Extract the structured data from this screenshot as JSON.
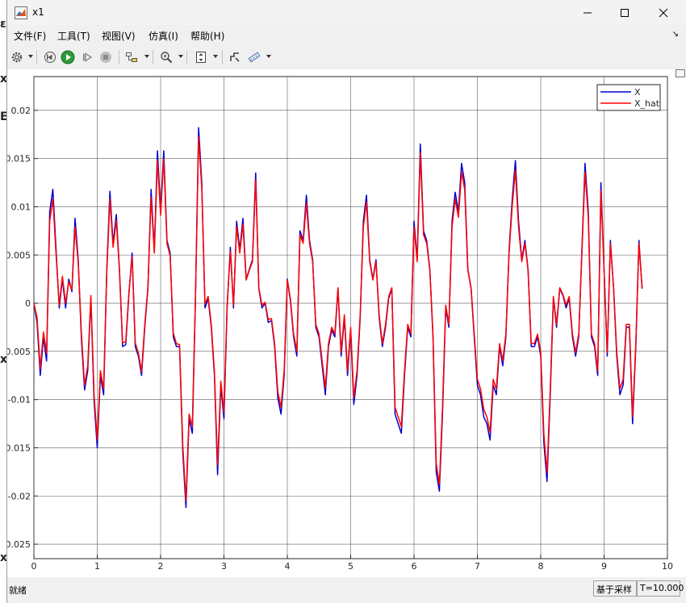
{
  "window": {
    "title": "x1"
  },
  "menu": {
    "items": [
      "文件(F)",
      "工具(T)",
      "视图(V)",
      "仿真(I)",
      "帮助(H)"
    ]
  },
  "toolbar": {
    "icons": [
      "gear-icon",
      "step-back-icon",
      "run-icon",
      "step-forward-icon",
      "stop-icon",
      "signal-select-icon",
      "zoom-icon",
      "fit-icon",
      "style-icon",
      "measure-icon"
    ]
  },
  "status": {
    "ready": "就绪",
    "sample_mode": "基于采样",
    "time": "T=10.000"
  },
  "colors": {
    "X": "#0000cd",
    "X_hat": "#ff0000"
  },
  "chart_data": {
    "type": "line",
    "xlim": [
      0,
      10
    ],
    "ylim": [
      -0.0265,
      0.0235
    ],
    "xticks": [
      "0",
      "1",
      "2",
      "3",
      "4",
      "5",
      "6",
      "7",
      "8",
      "9",
      "10"
    ],
    "yticks": [
      "0.02",
      "0.015",
      "0.01",
      "0.005",
      "0",
      "-0.005",
      "-0.01",
      "-0.015",
      "-0.02",
      "-0.025"
    ],
    "grid": true,
    "legend_position": "top-right",
    "series": [
      {
        "name": "X"
      },
      {
        "name": "X_hat"
      }
    ],
    "x": [
      0,
      0.05,
      0.1,
      0.15,
      0.2,
      0.25,
      0.3,
      0.35,
      0.4,
      0.45,
      0.5,
      0.55,
      0.6,
      0.65,
      0.7,
      0.75,
      0.8,
      0.85,
      0.9,
      0.95,
      1.0,
      1.05,
      1.1,
      1.15,
      1.2,
      1.25,
      1.3,
      1.35,
      1.4,
      1.45,
      1.5,
      1.55,
      1.6,
      1.65,
      1.7,
      1.75,
      1.8,
      1.85,
      1.9,
      1.95,
      2.0,
      2.05,
      2.1,
      2.15,
      2.2,
      2.25,
      2.3,
      2.35,
      2.4,
      2.45,
      2.5,
      2.55,
      2.6,
      2.65,
      2.7,
      2.75,
      2.8,
      2.85,
      2.9,
      2.95,
      3.0,
      3.05,
      3.1,
      3.15,
      3.2,
      3.25,
      3.3,
      3.35,
      3.4,
      3.45,
      3.5,
      3.55,
      3.6,
      3.65,
      3.7,
      3.75,
      3.8,
      3.85,
      3.9,
      3.95,
      4.0,
      4.05,
      4.1,
      4.15,
      4.2,
      4.25,
      4.3,
      4.35,
      4.4,
      4.45,
      4.5,
      4.55,
      4.6,
      4.65,
      4.7,
      4.75,
      4.8,
      4.85,
      4.9,
      4.95,
      5.0,
      5.05,
      5.1,
      5.15,
      5.2,
      5.25,
      5.3,
      5.35,
      5.4,
      5.45,
      5.5,
      5.55,
      5.6,
      5.65,
      5.7,
      5.75,
      5.8,
      5.85,
      5.9,
      5.95,
      6.0,
      6.05,
      6.1,
      6.15,
      6.2,
      6.25,
      6.3,
      6.35,
      6.4,
      6.45,
      6.5,
      6.55,
      6.6,
      6.65,
      6.7,
      6.75,
      6.8,
      6.85,
      6.9,
      6.95,
      7.0,
      7.05,
      7.1,
      7.15,
      7.2,
      7.25,
      7.3,
      7.35,
      7.4,
      7.45,
      7.5,
      7.55,
      7.6,
      7.65,
      7.7,
      7.75,
      7.8,
      7.85,
      7.9,
      7.95,
      8.0,
      8.05,
      8.1,
      8.15,
      8.2,
      8.25,
      8.3,
      8.35,
      8.4,
      8.45,
      8.5,
      8.55,
      8.6,
      8.65,
      8.7,
      8.75,
      8.8,
      8.85,
      8.9,
      8.95,
      9.0,
      9.05,
      9.1,
      9.15,
      9.2,
      9.25,
      9.3,
      9.35,
      9.4,
      9.45,
      9.5,
      9.55,
      9.6,
      9.65,
      9.7,
      9.75,
      9.8,
      9.85,
      9.9,
      9.95,
      10.0
    ],
    "x_values": [
      0,
      -0.002,
      -0.0075,
      -0.0035,
      -0.006,
      0.0095,
      0.0118,
      0.0055,
      -0.0005,
      0.0025,
      -0.0005,
      0.0025,
      0.0012,
      0.0088,
      0.0045,
      -0.0038,
      -0.009,
      -0.007,
      0.0005,
      -0.0102,
      -0.015,
      -0.0075,
      -0.0095,
      0.0035,
      0.0116,
      0.0062,
      0.0092,
      0.0035,
      -0.0045,
      -0.0043,
      0.001,
      0.0052,
      -0.0045,
      -0.0055,
      -0.0075,
      -0.0025,
      0.0015,
      0.0118,
      0.0055,
      0.0158,
      0.0095,
      0.0158,
      0.0065,
      0.0052,
      -0.0035,
      -0.0045,
      -0.0045,
      -0.0155,
      -0.0212,
      -0.012,
      -0.0135,
      0.0005,
      0.0182,
      0.0125,
      -0.0005,
      0.0005,
      -0.0025,
      -0.0075,
      -0.0178,
      -0.0085,
      -0.012,
      -0.0005,
      0.0058,
      -0.0005,
      0.0085,
      0.0055,
      0.0088,
      0.0025,
      0.0035,
      0.0045,
      0.0135,
      0.0015,
      -0.0005,
      0.0,
      -0.002,
      -0.0018,
      -0.0045,
      -0.0098,
      -0.0115,
      -0.0075,
      0.0025,
      0.0002,
      -0.0035,
      -0.0055,
      0.0075,
      0.0065,
      0.0112,
      0.0065,
      0.0045,
      -0.0025,
      -0.0035,
      -0.0065,
      -0.0095,
      -0.0045,
      -0.0028,
      -0.0035,
      0.0015,
      -0.0055,
      -0.0015,
      -0.0075,
      -0.0028,
      -0.0105,
      -0.0075,
      -0.0015,
      0.0085,
      0.0112,
      0.0045,
      0.0025,
      0.0045,
      -0.0015,
      -0.0045,
      -0.0025,
      0.0005,
      0.0015,
      -0.0115,
      -0.0125,
      -0.0135,
      -0.0075,
      -0.0025,
      -0.0035,
      0.0085,
      0.0045,
      0.0165,
      0.0075,
      0.0065,
      0.0035,
      -0.0035,
      -0.0175,
      -0.0195,
      -0.0115,
      -0.0005,
      -0.0025,
      0.0085,
      0.0115,
      0.0095,
      0.0145,
      0.0125,
      0.0035,
      0.0015,
      -0.0035,
      -0.0085,
      -0.0095,
      -0.0118,
      -0.0125,
      -0.0142,
      -0.0085,
      -0.0095,
      -0.0045,
      -0.0065,
      -0.0035,
      0.0055,
      0.0108,
      0.0148,
      0.0085,
      0.0045,
      0.0065,
      0.0035,
      -0.0045,
      -0.0045,
      -0.0035,
      -0.0055,
      -0.0145,
      -0.0185,
      -0.0095,
      0.0005,
      -0.0025,
      0.0015,
      0.0008,
      -0.0005,
      0.0005,
      -0.0035,
      -0.0055,
      -0.0035,
      0.0055,
      0.0145,
      0.0095,
      -0.0035,
      -0.0045,
      -0.0075,
      0.0125,
      0.0035,
      -0.0055,
      0.0065,
      0.0015,
      -0.0055,
      -0.0095,
      -0.0085,
      -0.0025,
      -0.0025,
      -0.0125,
      -0.0045,
      0.0065,
      0.0015
    ],
    "x_hat_values": [
      0,
      -0.0015,
      -0.0068,
      -0.003,
      -0.0052,
      0.0085,
      0.0108,
      0.005,
      -0.0002,
      0.0028,
      0.0,
      0.0022,
      0.0014,
      0.0079,
      0.0042,
      -0.0032,
      -0.0085,
      -0.0065,
      0.0008,
      -0.0095,
      -0.0142,
      -0.007,
      -0.0089,
      0.0032,
      0.0108,
      0.0058,
      0.0086,
      0.0034,
      -0.0041,
      -0.004,
      0.0012,
      0.0048,
      -0.0041,
      -0.0052,
      -0.0071,
      -0.0022,
      0.0017,
      0.011,
      0.0052,
      0.0148,
      0.0091,
      0.015,
      0.0062,
      0.0049,
      -0.0031,
      -0.0042,
      -0.0043,
      -0.0148,
      -0.0205,
      -0.0115,
      -0.0128,
      0.0008,
      0.0172,
      0.0119,
      -0.0001,
      0.0007,
      -0.0022,
      -0.0071,
      -0.0168,
      -0.0081,
      -0.0113,
      -0.0002,
      0.0054,
      -0.0002,
      0.0079,
      0.0052,
      0.0082,
      0.0024,
      0.0034,
      0.0043,
      0.0128,
      0.0016,
      -0.0002,
      0.0001,
      -0.0017,
      -0.0016,
      -0.0042,
      -0.0092,
      -0.0108,
      -0.007,
      0.0024,
      0.0004,
      -0.0032,
      -0.005,
      0.0071,
      0.0062,
      0.0104,
      0.0062,
      0.0043,
      -0.0022,
      -0.0032,
      -0.006,
      -0.0088,
      -0.0042,
      -0.0025,
      -0.0032,
      0.0016,
      -0.0051,
      -0.0012,
      -0.007,
      -0.0025,
      -0.0098,
      -0.007,
      -0.0012,
      0.0079,
      0.0105,
      0.0043,
      0.0024,
      0.0043,
      -0.0012,
      -0.0042,
      -0.0022,
      0.0007,
      0.0016,
      -0.0108,
      -0.0118,
      -0.0128,
      -0.007,
      -0.0022,
      -0.0032,
      0.0079,
      0.0043,
      0.0156,
      0.0071,
      0.0062,
      0.0034,
      -0.0032,
      -0.0166,
      -0.0188,
      -0.0108,
      -0.0002,
      -0.0022,
      0.0079,
      0.0108,
      0.0089,
      0.0136,
      0.0118,
      0.0034,
      0.0016,
      -0.0032,
      -0.0079,
      -0.0089,
      -0.011,
      -0.0118,
      -0.0134,
      -0.0079,
      -0.0089,
      -0.0042,
      -0.006,
      -0.0032,
      0.0052,
      0.0101,
      0.0138,
      0.0079,
      0.0043,
      0.0062,
      0.0034,
      -0.0042,
      -0.0042,
      -0.0032,
      -0.0051,
      -0.0136,
      -0.0176,
      -0.0089,
      0.0007,
      -0.0022,
      0.0016,
      0.0009,
      -0.0002,
      0.0007,
      -0.0032,
      -0.0051,
      -0.0032,
      0.0052,
      0.0136,
      0.0089,
      -0.0032,
      -0.0042,
      -0.007,
      0.0117,
      0.0034,
      -0.0051,
      0.0062,
      0.0016,
      -0.0051,
      -0.0089,
      -0.0079,
      -0.0022,
      -0.0022,
      -0.0118,
      -0.0042,
      0.0062,
      0.0016
    ]
  }
}
